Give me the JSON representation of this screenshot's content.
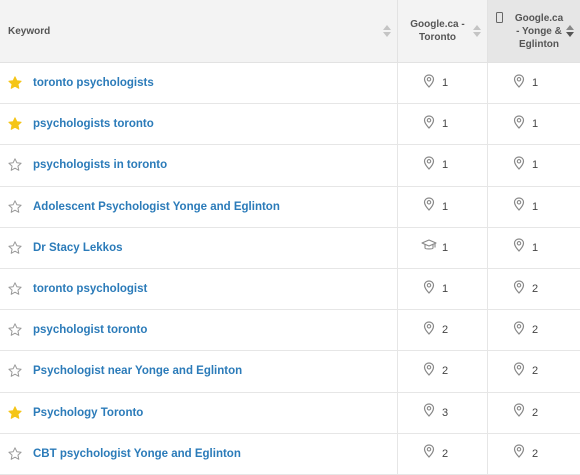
{
  "header": {
    "keyword": "Keyword",
    "col1": "Google.ca - Toronto",
    "col2": "Google.ca - Yonge & Eglinton"
  },
  "colors": {
    "link": "#2b7bb9",
    "star_active": "#f5c518",
    "star_inactive": "#9a9a9a",
    "icon": "#888888"
  },
  "rows": [
    {
      "keyword": "toronto psychologists",
      "starred": true,
      "r1": "1",
      "r1_icon": "map-pin-icon",
      "r2": "1",
      "r2_icon": "map-pin-icon"
    },
    {
      "keyword": "psychologists toronto",
      "starred": true,
      "r1": "1",
      "r1_icon": "map-pin-icon",
      "r2": "1",
      "r2_icon": "map-pin-icon"
    },
    {
      "keyword": "psychologists in toronto",
      "starred": false,
      "r1": "1",
      "r1_icon": "map-pin-icon",
      "r2": "1",
      "r2_icon": "map-pin-icon"
    },
    {
      "keyword": "Adolescent Psychologist Yonge and Eglinton",
      "starred": false,
      "r1": "1",
      "r1_icon": "map-pin-icon",
      "r2": "1",
      "r2_icon": "map-pin-icon"
    },
    {
      "keyword": "Dr Stacy Lekkos",
      "starred": false,
      "r1": "1",
      "r1_icon": "graduation-cap-icon",
      "r2": "1",
      "r2_icon": "map-pin-icon"
    },
    {
      "keyword": "toronto psychologist",
      "starred": false,
      "r1": "1",
      "r1_icon": "map-pin-icon",
      "r2": "2",
      "r2_icon": "map-pin-icon"
    },
    {
      "keyword": "psychologist toronto",
      "starred": false,
      "r1": "2",
      "r1_icon": "map-pin-icon",
      "r2": "2",
      "r2_icon": "map-pin-icon"
    },
    {
      "keyword": "Psychologist near Yonge and Eglinton",
      "starred": false,
      "r1": "2",
      "r1_icon": "map-pin-icon",
      "r2": "2",
      "r2_icon": "map-pin-icon"
    },
    {
      "keyword": "Psychology Toronto",
      "starred": true,
      "r1": "3",
      "r1_icon": "map-pin-icon",
      "r2": "2",
      "r2_icon": "map-pin-icon"
    },
    {
      "keyword": "CBT psychologist Yonge and Eglinton",
      "starred": false,
      "r1": "2",
      "r1_icon": "map-pin-icon",
      "r2": "2",
      "r2_icon": "map-pin-icon"
    }
  ]
}
